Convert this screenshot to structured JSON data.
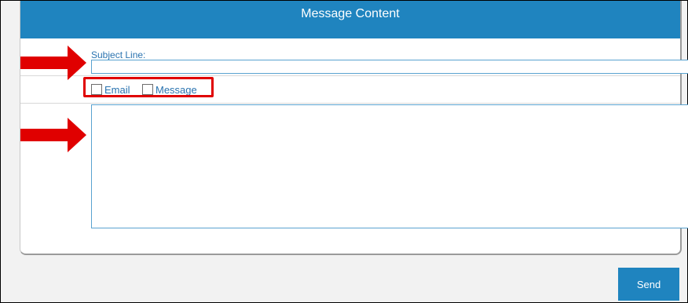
{
  "header": {
    "title": "Message Content"
  },
  "form": {
    "subject_label": "Subject Line:",
    "subject_value": "",
    "checkboxes": [
      {
        "label": "Email",
        "checked": false
      },
      {
        "label": "Message",
        "checked": false
      }
    ],
    "message_value": ""
  },
  "footer": {
    "send_label": "Send"
  },
  "annotations": {
    "arrow_color": "#e00000",
    "highlight_color": "#e00000"
  },
  "colors": {
    "accent": "#1f84bf",
    "label_text": "#2b74b0"
  }
}
